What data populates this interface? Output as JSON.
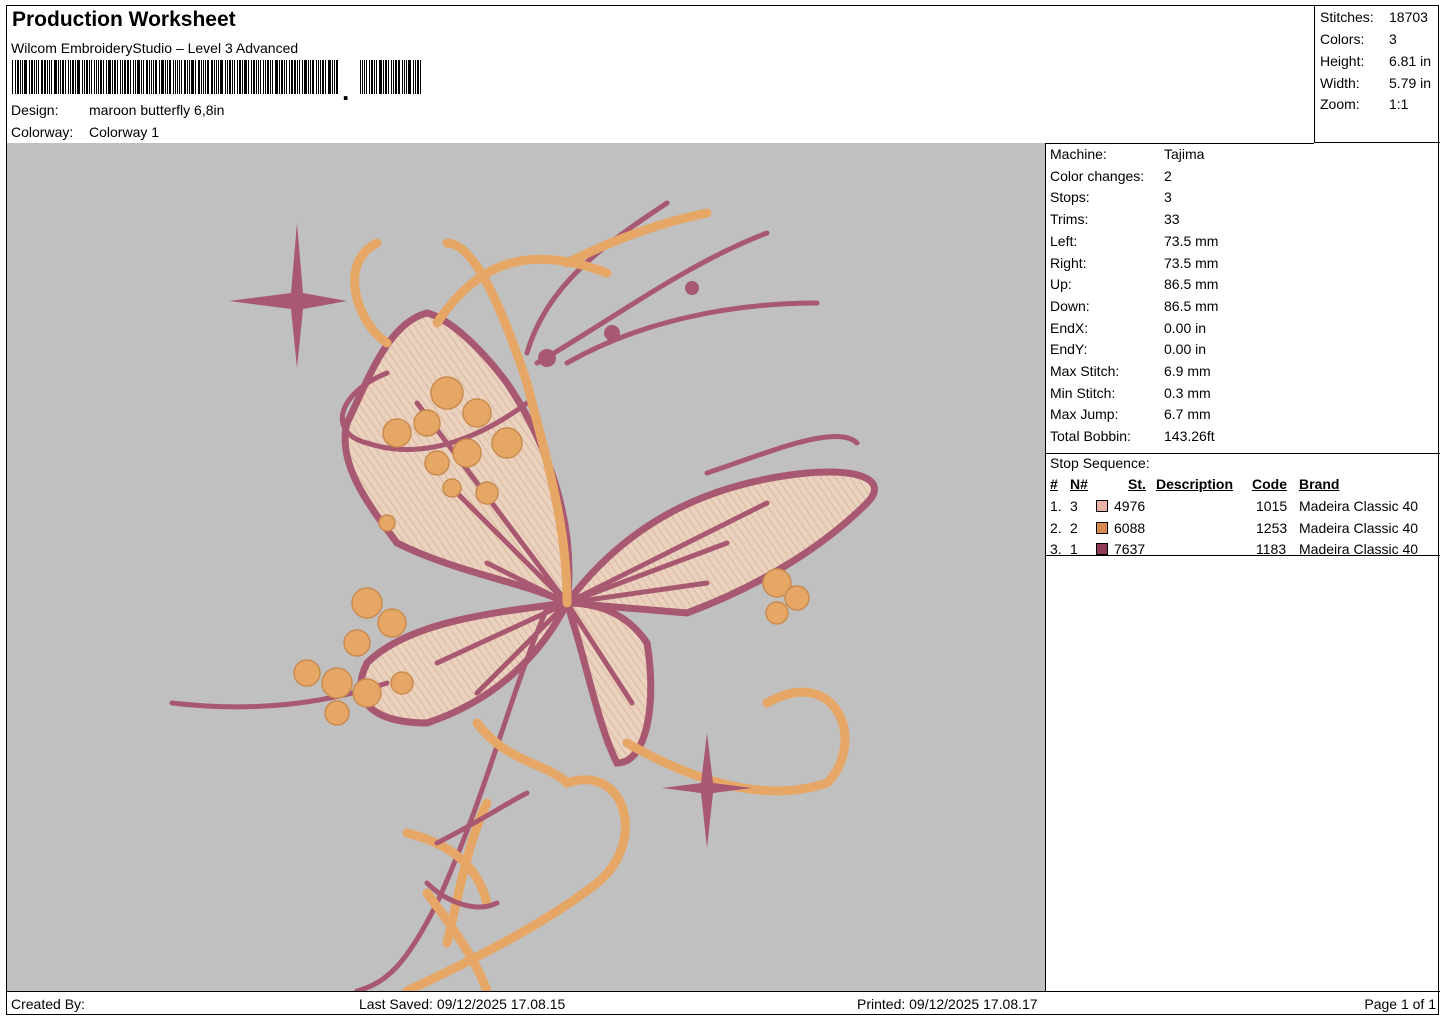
{
  "header": {
    "title": "Production Worksheet",
    "subtitle": "Wilcom EmbroideryStudio – Level 3 Advanced",
    "design_label": "Design:",
    "design_value": "maroon butterfly 6,8in",
    "colorway_label": "Colorway:",
    "colorway_value": "Colorway 1",
    "barcode_icon": "barcode-icon"
  },
  "stats": [
    {
      "label": "Stitches:",
      "value": "18703"
    },
    {
      "label": "Colors:",
      "value": "3"
    },
    {
      "label": "Height:",
      "value": "6.81 in"
    },
    {
      "label": "Width:",
      "value": "5.79 in"
    },
    {
      "label": "Zoom:",
      "value": "1:1"
    }
  ],
  "machine_info": [
    {
      "label": "Machine:",
      "value": "Tajima"
    },
    {
      "label": "Color changes:",
      "value": "2"
    },
    {
      "label": "Stops:",
      "value": "3"
    },
    {
      "label": "Trims:",
      "value": "33"
    },
    {
      "label": "Left:",
      "value": "73.5 mm"
    },
    {
      "label": "Right:",
      "value": "73.5 mm"
    },
    {
      "label": "Up:",
      "value": "86.5 mm"
    },
    {
      "label": "Down:",
      "value": "86.5 mm"
    },
    {
      "label": "EndX:",
      "value": "0.00 in"
    },
    {
      "label": "EndY:",
      "value": "0.00 in"
    },
    {
      "label": "Max Stitch:",
      "value": "6.9 mm"
    },
    {
      "label": "Min Stitch:",
      "value": "0.3 mm"
    },
    {
      "label": "Max Jump:",
      "value": "6.7 mm"
    },
    {
      "label": "Total Bobbin:",
      "value": "143.26ft"
    }
  ],
  "stop_sequence": {
    "title": "Stop Sequence:",
    "headers": {
      "num": "#",
      "n": "N#",
      "st": "St.",
      "description": "Description",
      "code": "Code",
      "brand": "Brand"
    },
    "rows": [
      {
        "num": "1.",
        "n": "3",
        "color": "#e8b4a4",
        "st": "4976",
        "code": "1015",
        "brand": "Madeira Classic 40"
      },
      {
        "num": "2.",
        "n": "2",
        "color": "#d98a50",
        "st": "6088",
        "code": "1253",
        "brand": "Madeira Classic 40"
      },
      {
        "num": "3.",
        "n": "1",
        "color": "#8e3a56",
        "st": "7637",
        "code": "1183",
        "brand": "Madeira Classic 40"
      }
    ]
  },
  "footer": {
    "created_by": "Created By:",
    "last_saved": "Last Saved: 09/12/2025 17.08.15",
    "printed": "Printed: 09/12/2025 17.08.17",
    "page": "Page 1 of 1"
  },
  "design_preview": {
    "subject": "maroon butterfly embroidery",
    "colors": {
      "background": "#c0c0c0",
      "fill": "#e8cbb4",
      "orange": "#e6a766",
      "maroon": "#a85870"
    }
  }
}
